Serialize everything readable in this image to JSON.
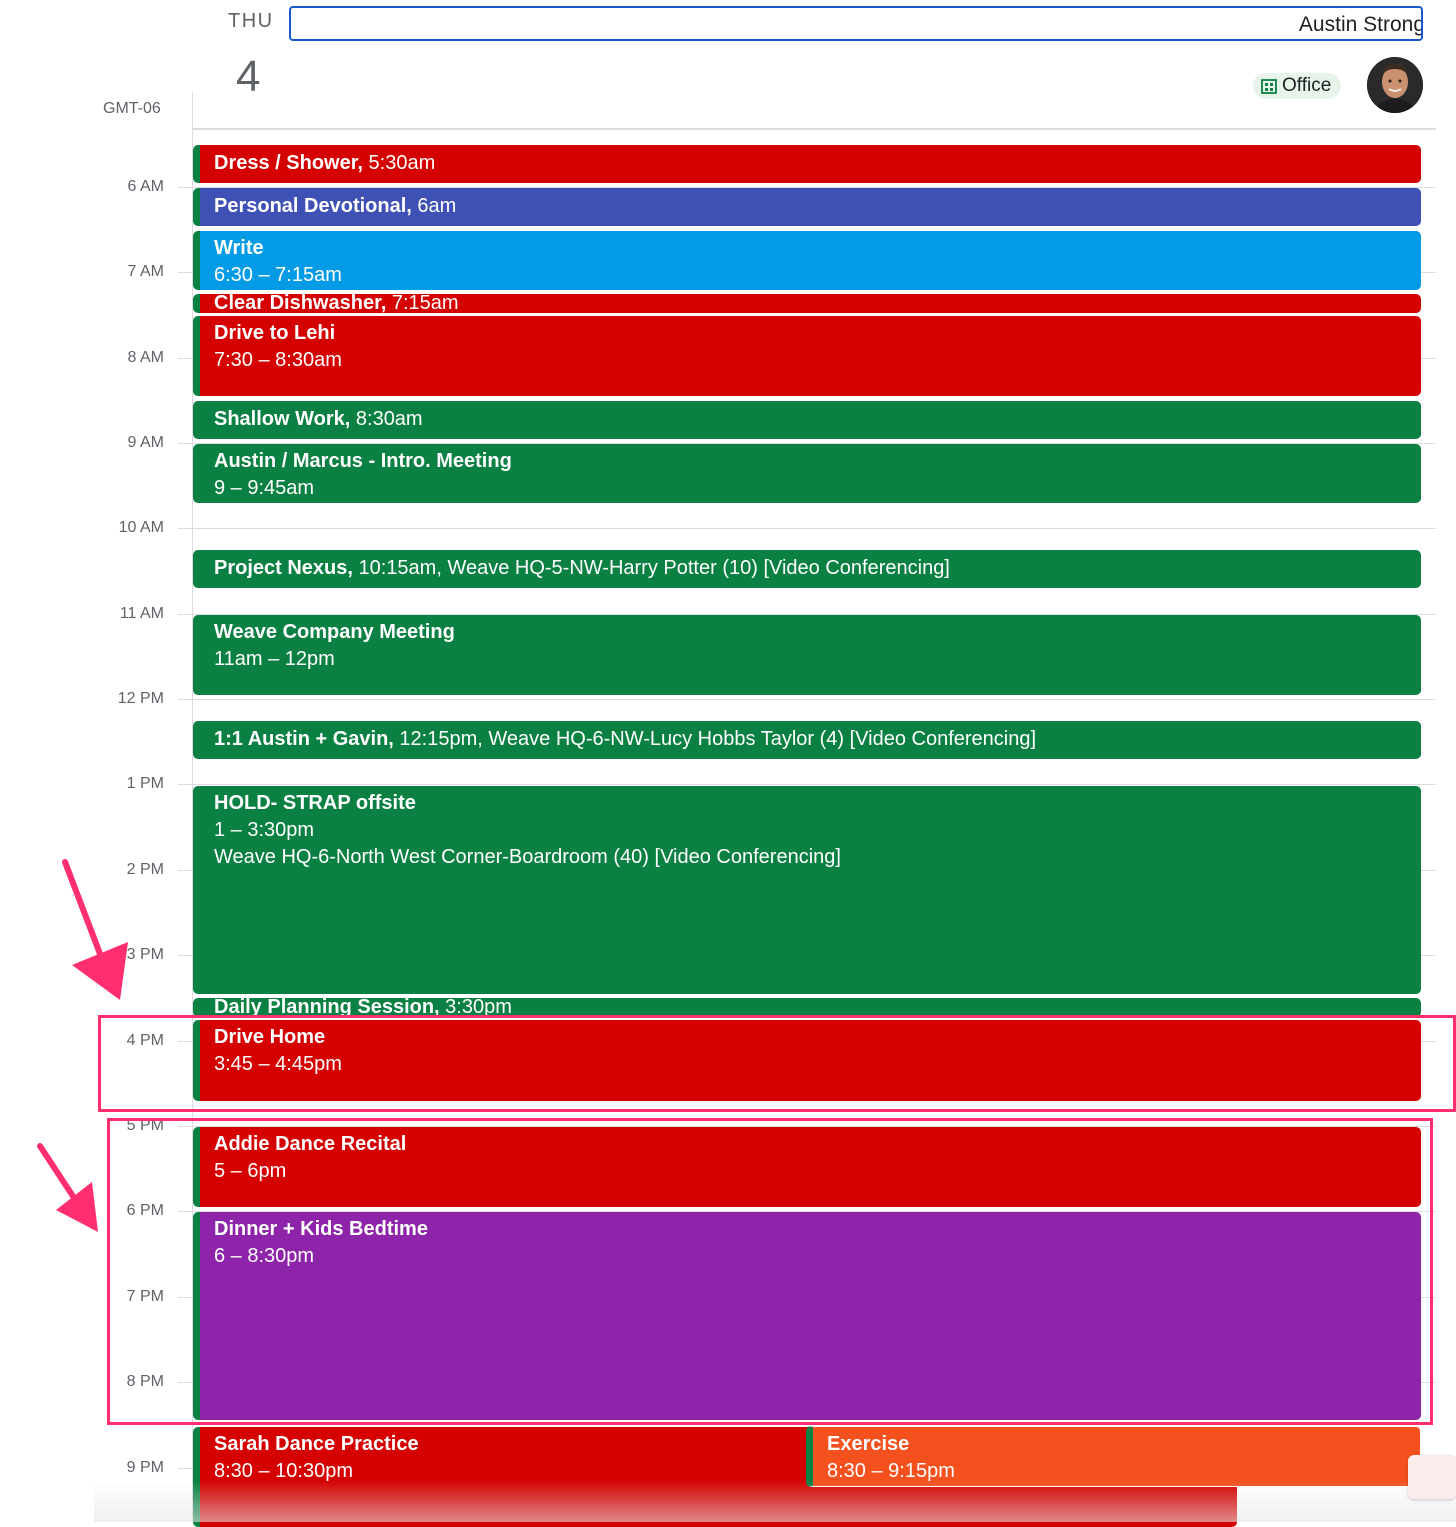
{
  "header": {
    "day_name": "THU",
    "day_number": "4",
    "timezone": "GMT-06",
    "calendar_input_value": "Austin Strong",
    "office_chip": {
      "label": "Office",
      "icon": "building-icon"
    },
    "avatar": {
      "icon": "user-avatar"
    }
  },
  "hours": [
    {
      "label": "6 AM"
    },
    {
      "label": "7 AM"
    },
    {
      "label": "8 AM"
    },
    {
      "label": "9 AM"
    },
    {
      "label": "10 AM"
    },
    {
      "label": "11 AM"
    },
    {
      "label": "12 PM"
    },
    {
      "label": "1 PM"
    },
    {
      "label": "2 PM"
    },
    {
      "label": "3 PM"
    },
    {
      "label": "4 PM"
    },
    {
      "label": "5 PM"
    },
    {
      "label": "6 PM"
    },
    {
      "label": "7 PM"
    },
    {
      "label": "8 PM"
    },
    {
      "label": "9 PM"
    }
  ],
  "events": [
    {
      "title": "Dress / Shower,",
      "detail": " 5:30am",
      "color": "#d50000"
    },
    {
      "title": "Personal Devotional,",
      "detail": " 6am",
      "color": "#3f51b5"
    },
    {
      "title": "Write",
      "detail": "6:30 – 7:15am",
      "color": "#039be5"
    },
    {
      "title": "Clear Dishwasher,",
      "detail": " 7:15am",
      "color": "#d50000"
    },
    {
      "title": "Drive to Lehi",
      "detail": "7:30 – 8:30am",
      "color": "#d50000"
    },
    {
      "title": "Shallow Work,",
      "detail": " 8:30am",
      "color": "#0b8043"
    },
    {
      "title": "Austin / Marcus - Intro. Meeting",
      "detail": "9 – 9:45am",
      "color": "#0b8043"
    },
    {
      "title": "Project Nexus,",
      "detail": " 10:15am, Weave HQ-5-NW-Harry Potter (10) [Video Conferencing]",
      "color": "#0b8043"
    },
    {
      "title": "Weave Company Meeting",
      "detail": "11am – 12pm",
      "color": "#0b8043"
    },
    {
      "title": "1:1 Austin + Gavin,",
      "detail": " 12:15pm, Weave HQ-6-NW-Lucy Hobbs Taylor (4) [Video Conferencing]",
      "color": "#0b8043"
    },
    {
      "title": "HOLD- STRAP offsite",
      "detail": "1 – 3:30pm",
      "location": "Weave HQ-6-North West Corner-Boardroom (40) [Video Conferencing]",
      "color": "#0b8043"
    },
    {
      "title": "Daily Planning Session,",
      "detail": " 3:30pm",
      "color": "#0b8043"
    },
    {
      "title": "Drive Home",
      "detail": "3:45 – 4:45pm",
      "color": "#d50000"
    },
    {
      "title": "Addie Dance Recital",
      "detail": "5 – 6pm",
      "color": "#d50000"
    },
    {
      "title": "Dinner + Kids Bedtime",
      "detail": "6 – 8:30pm",
      "color": "#8e24aa"
    },
    {
      "title": "Sarah Dance Practice",
      "detail": "8:30 – 10:30pm",
      "color": "#d50000"
    },
    {
      "title": "Exercise",
      "detail": "8:30 – 9:15pm",
      "color": "#f4511e"
    }
  ],
  "colors": {
    "accent": "#1a57c8",
    "highlight": "#ff2e6e"
  }
}
